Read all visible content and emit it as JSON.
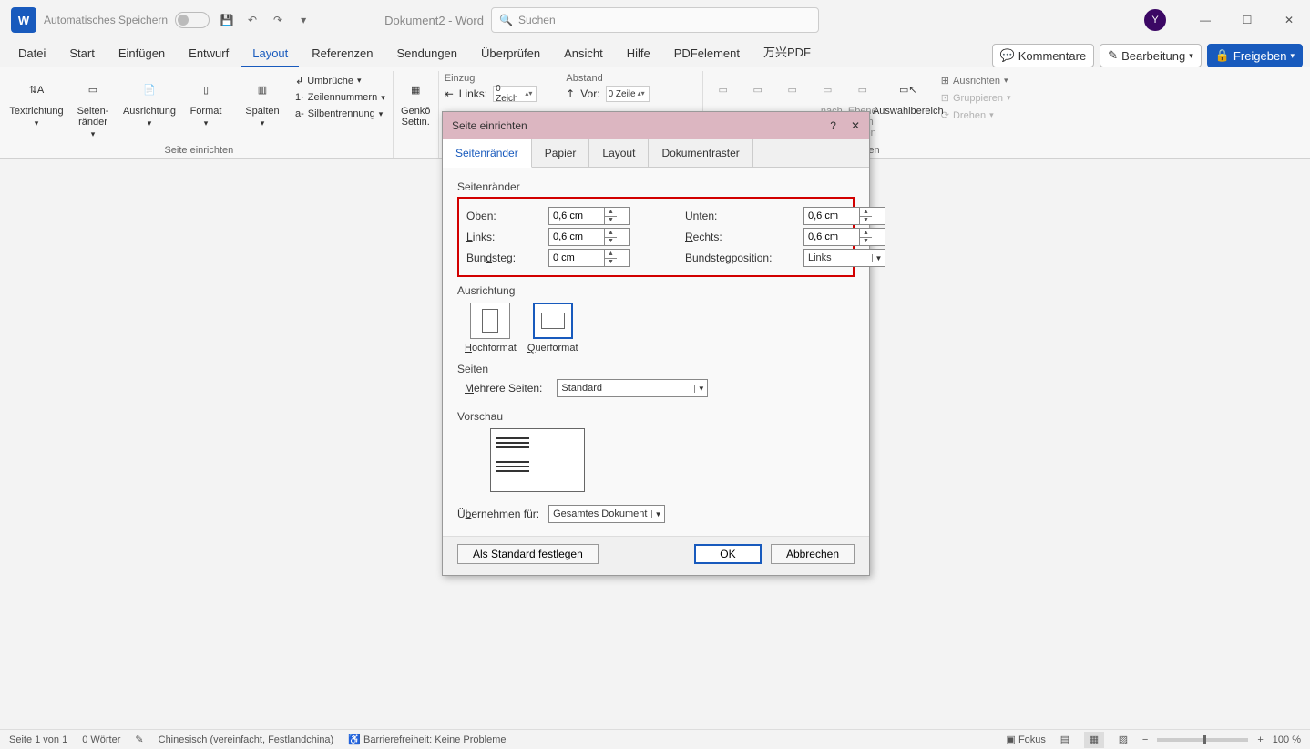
{
  "titlebar": {
    "autosave": "Automatisches Speichern",
    "doc_title": "Dokument2 - Word",
    "search_placeholder": "Suchen",
    "avatar_initial": "Y"
  },
  "tabs": {
    "items": [
      "Datei",
      "Start",
      "Einfügen",
      "Entwurf",
      "Layout",
      "Referenzen",
      "Sendungen",
      "Überprüfen",
      "Ansicht",
      "Hilfe",
      "PDFelement",
      "万兴PDF"
    ],
    "active_index": 4,
    "comments": "Kommentare",
    "editing": "Bearbeitung",
    "share": "Freigeben"
  },
  "ribbon": {
    "g1": {
      "textdir": "Textrichtung",
      "margins": "Seiten-\nränder",
      "orient": "Ausrichtung",
      "format": "Format",
      "columns": "Spalten",
      "breaks": "Umbrüche",
      "line_numbers": "Zeilennummern",
      "hyphen": "Silbentrennung",
      "label": "Seite einrichten"
    },
    "g2": {
      "genko": "Genkō\nSettin.",
      "label": ""
    },
    "g3": {
      "einzug": "Einzug",
      "abstand": "Abstand",
      "links": "Links:",
      "vor": "Vor:",
      "val1": "0 Zeich",
      "val2": "0 Zeile"
    },
    "g5": {
      "nach": "...nach\nhinten",
      "ebene": "Ebene nach\nhinten",
      "auswahl": "Auswahlbereich",
      "align": "Ausrichten",
      "group": "Gruppieren",
      "rotate": "Drehen",
      "label": "Anordnen"
    }
  },
  "dialog": {
    "title": "Seite einrichten",
    "tabs": [
      "Seitenränder",
      "Papier",
      "Layout",
      "Dokumentraster"
    ],
    "active_tab": 0,
    "s_margins": "Seitenränder",
    "oben": "Oben:",
    "unten": "Unten:",
    "links": "Links:",
    "rechts": "Rechts:",
    "bundsteg": "Bundsteg:",
    "bundpos": "Bundstegposition:",
    "v_oben": "0,6 cm",
    "v_unten": "0,6 cm",
    "v_links": "0,6 cm",
    "v_rechts": "0,6 cm",
    "v_bund": "0 cm",
    "v_bundpos": "Links",
    "s_orient": "Ausrichtung",
    "hoch": "Hochformat",
    "quer": "Querformat",
    "s_pages": "Seiten",
    "multi": "Mehrere Seiten:",
    "v_multi": "Standard",
    "s_preview": "Vorschau",
    "apply": "Übernehmen für:",
    "v_apply": "Gesamtes Dokument",
    "default": "Als Standard festlegen",
    "ok": "OK",
    "cancel": "Abbrechen"
  },
  "status": {
    "page": "Seite 1 von 1",
    "words": "0 Wörter",
    "lang": "Chinesisch (vereinfacht, Festlandchina)",
    "a11y": "Barrierefreiheit: Keine Probleme",
    "focus": "Fokus",
    "zoom": "100 %"
  }
}
